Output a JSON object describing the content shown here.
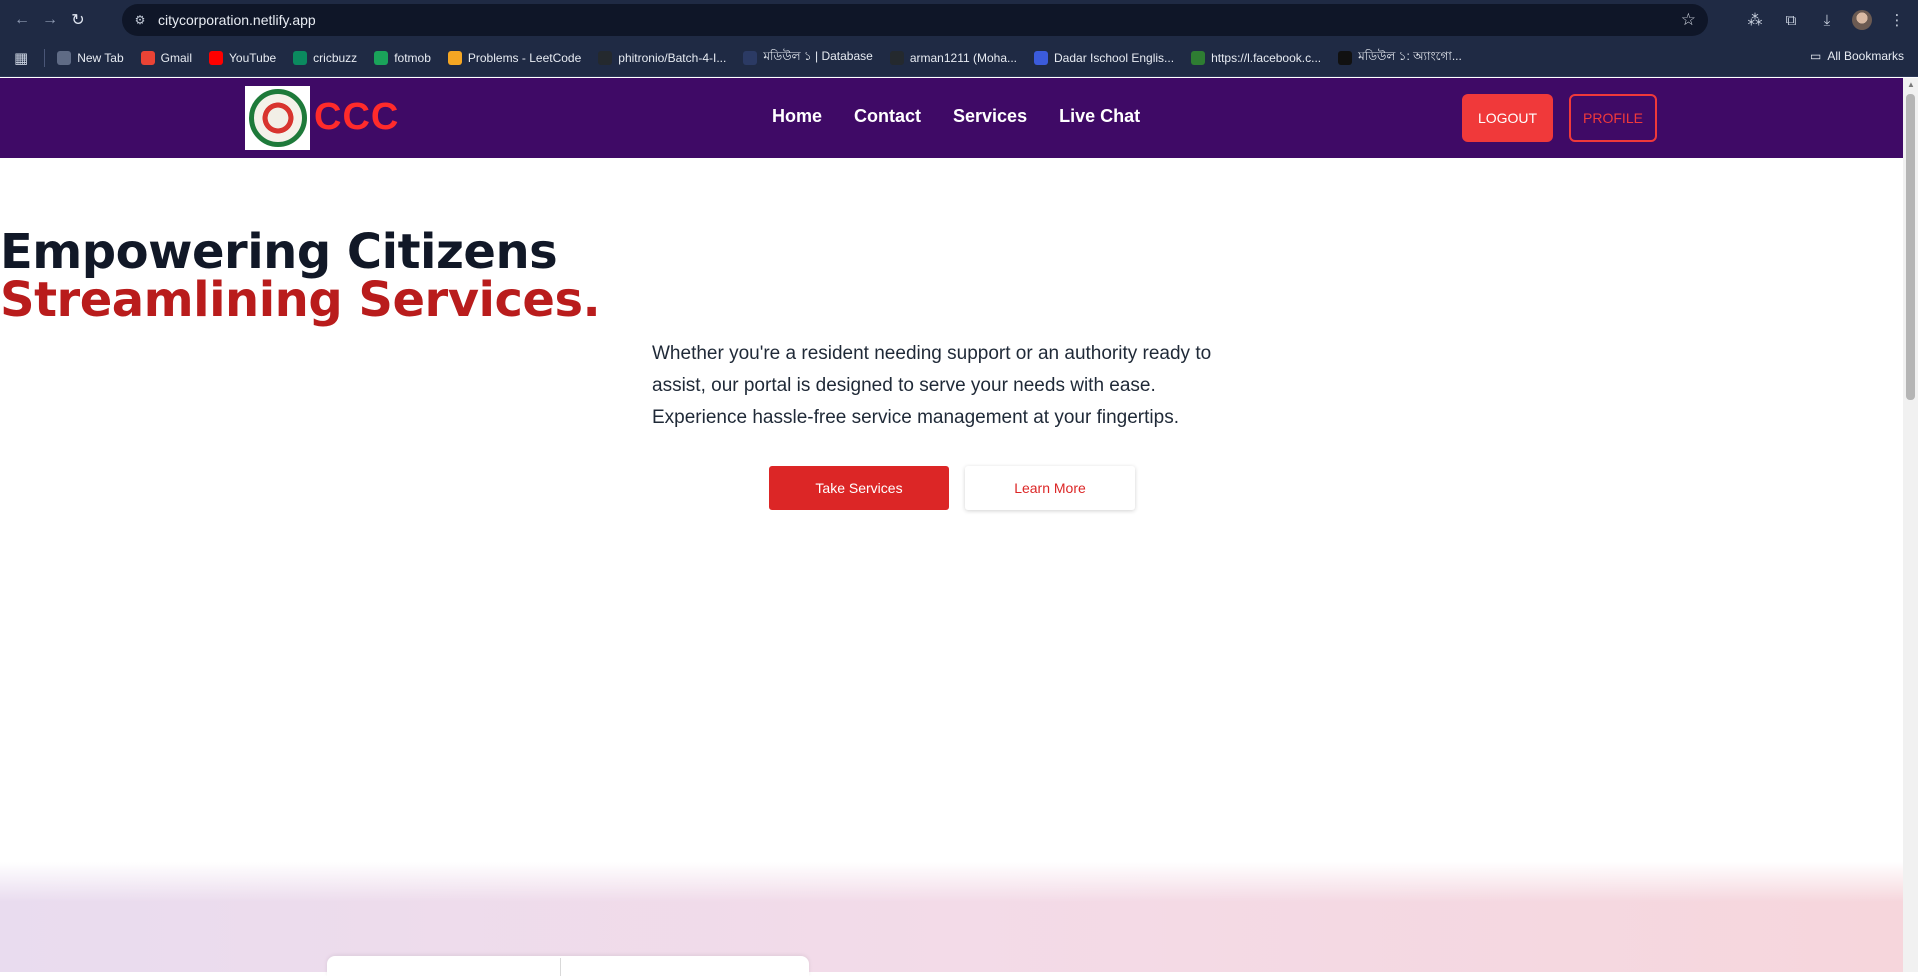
{
  "browser": {
    "url": "citycorporation.netlify.app",
    "bookmarks": [
      {
        "label": "New Tab",
        "icon": "globe-icon",
        "color": "#5f6b85"
      },
      {
        "label": "Gmail",
        "icon": "gmail-icon",
        "color": "#ea4335"
      },
      {
        "label": "YouTube",
        "icon": "youtube-icon",
        "color": "#ff0000"
      },
      {
        "label": "cricbuzz",
        "icon": "cricbuzz-icon",
        "color": "#0b8a5f"
      },
      {
        "label": "fotmob",
        "icon": "fotmob-icon",
        "color": "#1aa35a"
      },
      {
        "label": "Problems - LeetCode",
        "icon": "leetcode-icon",
        "color": "#f5a623"
      },
      {
        "label": "phitronio/Batch-4-I...",
        "icon": "github-icon",
        "color": "#24292e"
      },
      {
        "label": "মডিউল ১ | Database",
        "icon": "doc-icon",
        "color": "#2b3a64"
      },
      {
        "label": "arman1211 (Moha...",
        "icon": "github-icon",
        "color": "#24292e"
      },
      {
        "label": "Dadar Ischool Englis...",
        "icon": "school-icon",
        "color": "#3b5bdb"
      },
      {
        "label": "https://l.facebook.c...",
        "icon": "link-icon",
        "color": "#2e7d32"
      },
      {
        "label": "মডিউল ১: অ্যাংগো...",
        "icon": "d-icon",
        "color": "#111111"
      }
    ],
    "all_bookmarks": "All Bookmarks"
  },
  "navbar": {
    "logo_text": "CCC",
    "menu": [
      "Home",
      "Contact",
      "Services",
      "Live Chat"
    ],
    "logout": "LOGOUT",
    "profile": "PROFILE"
  },
  "hero": {
    "title_line1": "Empowering Citizens",
    "title_line2": "Streamlining Services.",
    "description": "Whether you're a resident needing support or an authority ready to assist, our portal is designed to serve your needs with ease. Experience hassle-free service management at your fingertips.",
    "primary_button": "Take Services",
    "secondary_button": "Learn More"
  },
  "colors": {
    "navbar_bg": "#3f0a66",
    "accent_red": "#dc2626",
    "logo_red": "#ff2b2b"
  }
}
